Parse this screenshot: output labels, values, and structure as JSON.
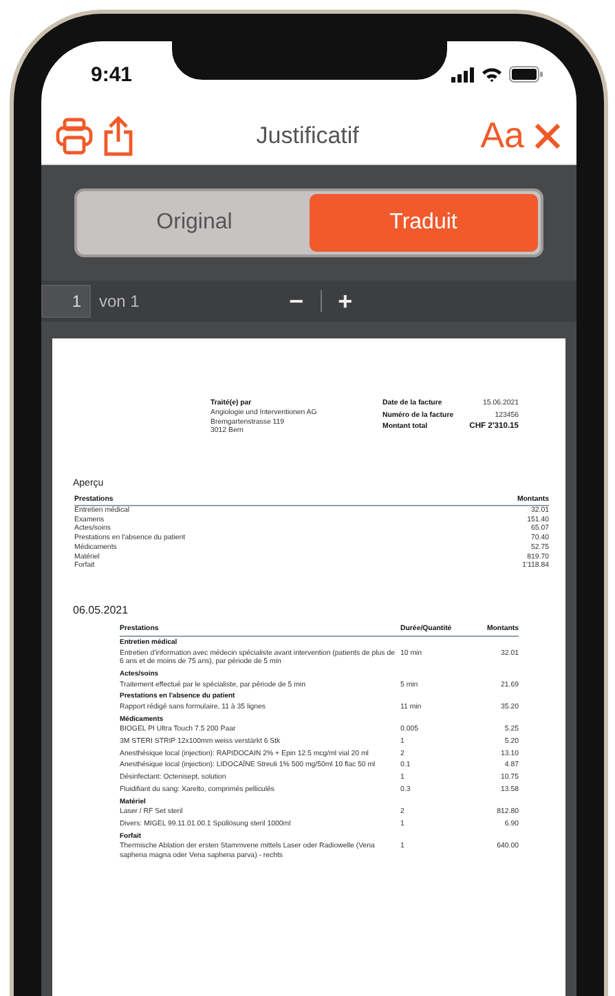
{
  "status_bar": {
    "time": "9:41"
  },
  "header": {
    "title": "Justificatif",
    "font_button": "Aa"
  },
  "segments": [
    {
      "label": "Original",
      "selected": false
    },
    {
      "label": "Traduit",
      "selected": true
    }
  ],
  "pager": {
    "page": "1",
    "of": "von 1",
    "minus": "−",
    "plus": "+"
  },
  "document": {
    "issuer": {
      "label": "Traité(e) par",
      "lines": [
        "Angiologie und Interventionen AG",
        "Bremgartenstrasse 119",
        "3012 Bern"
      ]
    },
    "invoice_info": [
      {
        "label": "Date de la facture",
        "value": "15.06.2021",
        "emphasis": false
      },
      {
        "label": "Numéro de la facture",
        "value": "123456",
        "emphasis": false
      },
      {
        "label": "Montant total",
        "value": "CHF 2'310.15",
        "emphasis": true
      }
    ],
    "overview": {
      "title": "Aperçu",
      "columns": [
        "Prestations",
        "Montants"
      ],
      "rows": [
        {
          "name": "Entretien médical",
          "amount": "32.01"
        },
        {
          "name": "Examens",
          "amount": "151.40"
        },
        {
          "name": "Actes/soins",
          "amount": "65.07"
        },
        {
          "name": "Prestations en l'absence du patient",
          "amount": "70.40"
        },
        {
          "name": "Médicaments",
          "amount": "52.75"
        },
        {
          "name": "Matériel",
          "amount": "819.70"
        },
        {
          "name": "Forfait",
          "amount": "1'118.84"
        }
      ]
    },
    "day": {
      "title": "06.05.2021",
      "columns": [
        "Prestations",
        "Durée/Quantité",
        "Montants"
      ],
      "groups": [
        {
          "title": "Entretien médical",
          "items": [
            {
              "description": "Entretien d'information avec médecin spécialiste avant intervention (patients de plus de 6 ans et de moins de 75 ans), par période de 5 min",
              "quantity": "10 min",
              "amount": "32.01"
            }
          ]
        },
        {
          "title": "Actes/soins",
          "items": [
            {
              "description": "Traitement effectué par le spécialiste, par période de 5 min",
              "quantity": "5 min",
              "amount": "21.69"
            }
          ]
        },
        {
          "title": "Prestations en l'absence du patient",
          "items": [
            {
              "description": "Rapport rédigé sans formulaire, 11 à 35 lignes",
              "quantity": "11 min",
              "amount": "35.20"
            }
          ]
        },
        {
          "title": "Médicaments",
          "items": [
            {
              "description": "BIOGEL PI Ultra Touch 7.5 200 Paar",
              "quantity": "0.005",
              "amount": "5.25"
            },
            {
              "description": "3M STERI STRIP 12x100mm weiss verstärkt 6 Stk",
              "quantity": "1",
              "amount": "5.20"
            },
            {
              "description": "Anesthésique local (injection): RAPIDOCAIN 2% + Epin 12.5 mcg/ml vial 20 ml",
              "quantity": "2",
              "amount": "13.10"
            },
            {
              "description": "Anesthésique local (injection): LIDOCAÏNE Streuli 1% 500 mg/50ml 10 flac 50 ml",
              "quantity": "0.1",
              "amount": "4.87"
            },
            {
              "description": "Désinfectant: Octenisept, solution",
              "quantity": "1",
              "amount": "10.75"
            },
            {
              "description": "Fluidifiant du sang: Xarelto, comprimés pelliculés",
              "quantity": "0.3",
              "amount": "13.58"
            }
          ]
        },
        {
          "title": "Matériel",
          "items": [
            {
              "description": "Laser / RF Set steril",
              "quantity": "2",
              "amount": "812.80"
            },
            {
              "description": "Divers: MIGEL 99.11.01.00.1 Spüllösung steril 1000ml",
              "quantity": "1",
              "amount": "6.90"
            }
          ]
        },
        {
          "title": "Forfait",
          "items": [
            {
              "description": "Thermische Ablation der ersten Stammvene mittels Laser oder Radiowelle (Vena saphena magna oder Vena saphena parva) - rechts",
              "quantity": "1",
              "amount": "640.00"
            }
          ]
        }
      ]
    }
  }
}
